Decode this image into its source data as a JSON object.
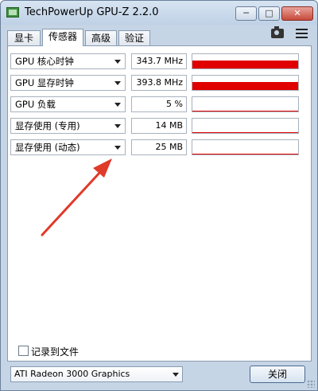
{
  "window": {
    "title": "TechPowerUp GPU-Z 2.2.0",
    "minimize_label": "─",
    "maximize_label": "□",
    "close_label": "✕"
  },
  "tabs": [
    {
      "label": "显卡",
      "active": false
    },
    {
      "label": "传感器",
      "active": true
    },
    {
      "label": "高级",
      "active": false
    },
    {
      "label": "验证",
      "active": false
    }
  ],
  "toolbar": {
    "camera_icon": "camera-icon",
    "menu_icon": "menu-icon"
  },
  "sensors": [
    {
      "label": "GPU 核心时钟",
      "value": "343.7 MHz",
      "graph_level": 0.55
    },
    {
      "label": "GPU 显存时钟",
      "value": "393.8 MHz",
      "graph_level": 0.55
    },
    {
      "label": "GPU 负载",
      "value": "5 %",
      "graph_level": 0.05
    },
    {
      "label": "显存使用 (专用)",
      "value": "14 MB",
      "graph_level": 0.03
    },
    {
      "label": "显存使用 (动态)",
      "value": "25 MB",
      "graph_level": 0.06
    }
  ],
  "log_to_file": {
    "label": "记录到文件",
    "checked": false
  },
  "gpu_select": {
    "value": "ATI Radeon 3000 Graphics"
  },
  "close_button": {
    "label": "关闭"
  },
  "colors": {
    "graph": "#e00000",
    "annotation_arrow": "#e03a2a",
    "window_frame": "#c6d5e6"
  }
}
